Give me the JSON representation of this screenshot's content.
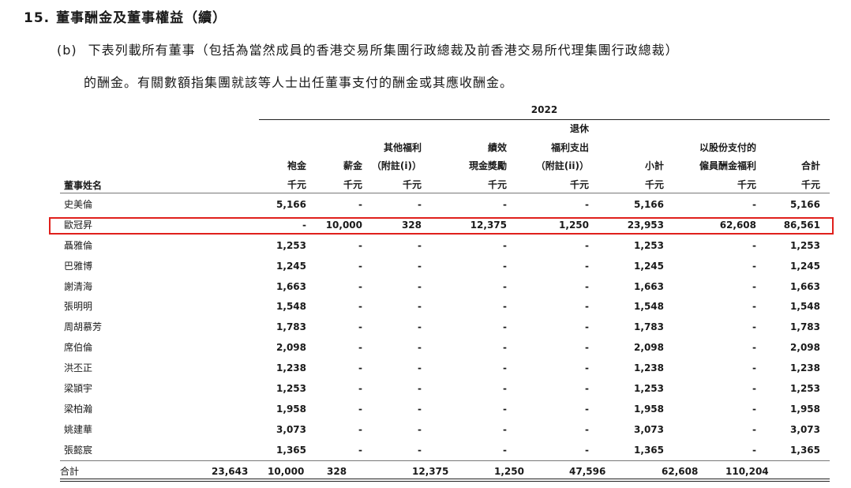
{
  "heading": {
    "number": "15.",
    "title": "董事酬金及董事權益（續）"
  },
  "intro": {
    "label": "(b)",
    "line1": "下表列載所有董事（包括為當然成員的香港交易所集團行政總裁及前香港交易所代理集團行政總裁）",
    "line2": "的酬金。有關數額指集團就該等人士出任董事支付的酬金或其應收酬金。"
  },
  "table": {
    "year": "2022",
    "name_header": "董事姓名",
    "columns": [
      {
        "lines": [
          "袍金"
        ],
        "unit": "千元"
      },
      {
        "lines": [
          "薪金"
        ],
        "unit": "千元"
      },
      {
        "lines": [
          "其他福利",
          "（附註(i)）"
        ],
        "unit": "千元"
      },
      {
        "lines": [
          "績效",
          "現金獎勵"
        ],
        "unit": "千元"
      },
      {
        "lines": [
          "退休",
          "福利支出",
          "（附註(ii)）"
        ],
        "unit": "千元"
      },
      {
        "lines": [
          "小計"
        ],
        "unit": "千元"
      },
      {
        "lines": [
          "以股份支付的",
          "僱員酬金福利"
        ],
        "unit": "千元"
      },
      {
        "lines": [
          "合計"
        ],
        "unit": "千元"
      }
    ],
    "rows": [
      {
        "name": "史美倫",
        "values": [
          "5,166",
          "-",
          "-",
          "-",
          "-",
          "5,166",
          "-",
          "5,166"
        ]
      },
      {
        "name": "歐冠昇",
        "values": [
          "-",
          "10,000",
          "328",
          "12,375",
          "1,250",
          "23,953",
          "62,608",
          "86,561"
        ]
      },
      {
        "name": "聶雅倫",
        "values": [
          "1,253",
          "-",
          "-",
          "-",
          "-",
          "1,253",
          "-",
          "1,253"
        ]
      },
      {
        "name": "巴雅博",
        "values": [
          "1,245",
          "-",
          "-",
          "-",
          "-",
          "1,245",
          "-",
          "1,245"
        ]
      },
      {
        "name": "謝清海",
        "values": [
          "1,663",
          "-",
          "-",
          "-",
          "-",
          "1,663",
          "-",
          "1,663"
        ]
      },
      {
        "name": "張明明",
        "values": [
          "1,548",
          "-",
          "-",
          "-",
          "-",
          "1,548",
          "-",
          "1,548"
        ]
      },
      {
        "name": "周胡慕芳",
        "values": [
          "1,783",
          "-",
          "-",
          "-",
          "-",
          "1,783",
          "-",
          "1,783"
        ]
      },
      {
        "name": "席伯倫",
        "values": [
          "2,098",
          "-",
          "-",
          "-",
          "-",
          "2,098",
          "-",
          "2,098"
        ]
      },
      {
        "name": "洪丕正",
        "values": [
          "1,238",
          "-",
          "-",
          "-",
          "-",
          "1,238",
          "-",
          "1,238"
        ]
      },
      {
        "name": "梁頴宇",
        "values": [
          "1,253",
          "-",
          "-",
          "-",
          "-",
          "1,253",
          "-",
          "1,253"
        ]
      },
      {
        "name": "梁柏瀚",
        "values": [
          "1,958",
          "-",
          "-",
          "-",
          "-",
          "1,958",
          "-",
          "1,958"
        ]
      },
      {
        "name": "姚建華",
        "values": [
          "3,073",
          "-",
          "-",
          "-",
          "-",
          "3,073",
          "-",
          "3,073"
        ]
      },
      {
        "name": "張懿宸",
        "values": [
          "1,365",
          "-",
          "-",
          "-",
          "-",
          "1,365",
          "-",
          "1,365"
        ]
      }
    ],
    "total": {
      "name": "合計",
      "values": [
        "23,643",
        "10,000",
        "328",
        "12,375",
        "1,250",
        "47,596",
        "62,608",
        "110,204"
      ]
    },
    "highlight_color": "#e0201c"
  }
}
